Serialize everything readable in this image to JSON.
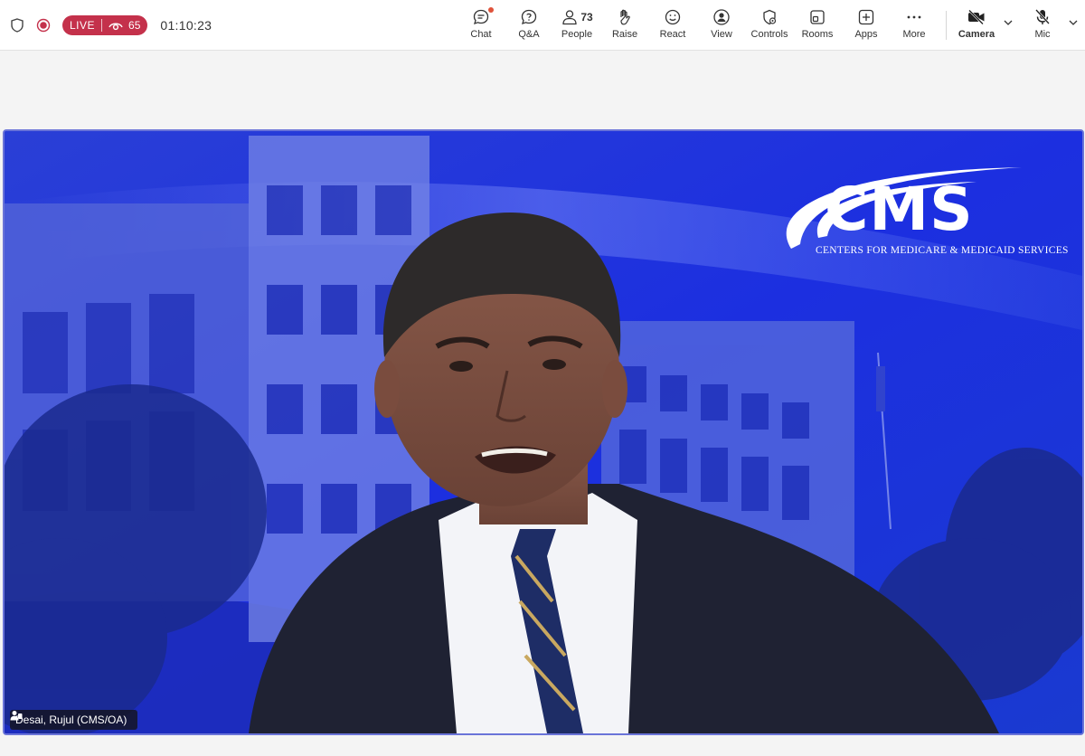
{
  "status": {
    "live_label": "LIVE",
    "viewer_count": "65",
    "elapsed_time": "01:10:23"
  },
  "toolbar": {
    "chat": "Chat",
    "qa": "Q&A",
    "people": "People",
    "people_count": "73",
    "raise": "Raise",
    "react": "React",
    "view": "View",
    "controls": "Controls",
    "rooms": "Rooms",
    "apps": "Apps",
    "more": "More",
    "camera": "Camera",
    "mic": "Mic"
  },
  "stage": {
    "logo_text": "CMS",
    "logo_subtitle": "CENTERS FOR MEDICARE & MEDICAID SERVICES",
    "participant_name": "Desai, Rujul (CMS/OA)"
  },
  "colors": {
    "live_red": "#c4314b",
    "stage_blue": "#1f2fc8",
    "stage_border": "#6a74d8"
  }
}
